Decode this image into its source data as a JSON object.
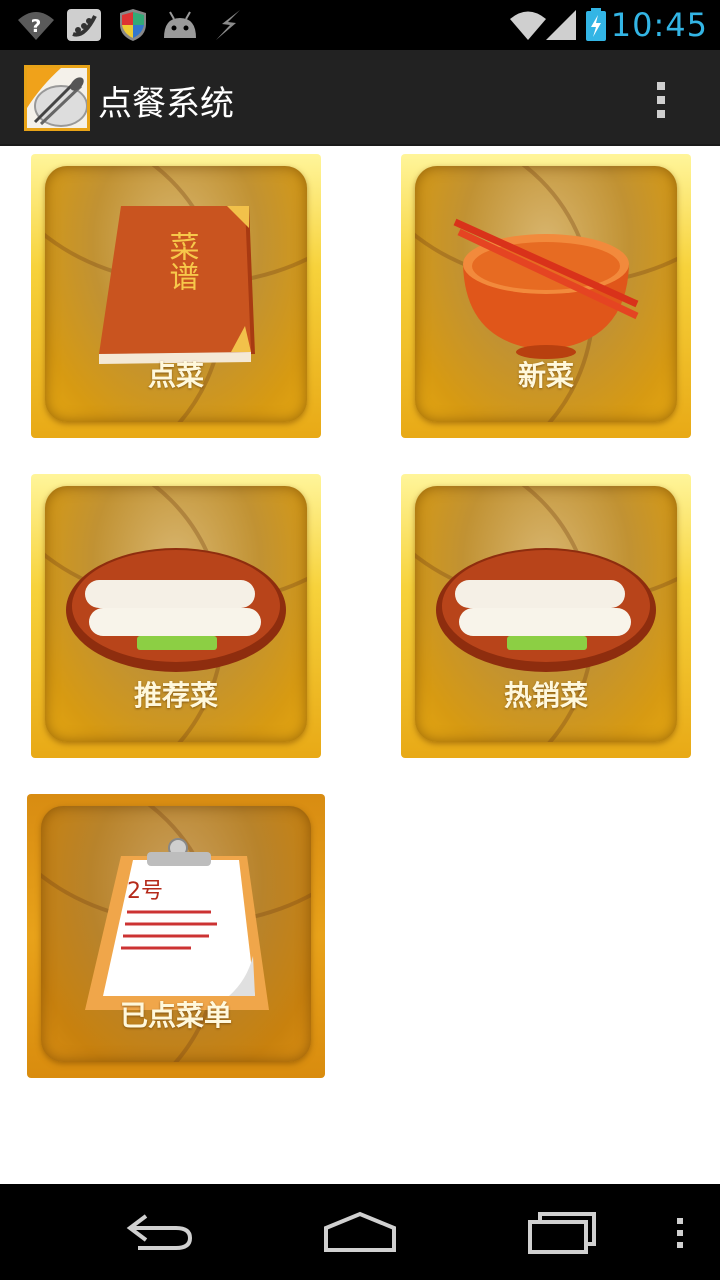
{
  "status_bar": {
    "time": "10:45",
    "icons": [
      "wifi-unknown-icon",
      "peas-notification-icon",
      "shield-icon",
      "android-icon",
      "flash-icon",
      "wifi-icon",
      "signal-icon",
      "battery-charging-icon"
    ]
  },
  "action_bar": {
    "title": "点餐系统",
    "app_icon": "plate-utensils-icon",
    "menu_icon": "overflow-menu-icon"
  },
  "tiles": [
    {
      "label": "点菜",
      "icon": "menu-book-icon",
      "book_text": "菜谱"
    },
    {
      "label": "新菜",
      "icon": "bowl-chopsticks-icon"
    },
    {
      "label": "推荐菜",
      "icon": "dumpling-plate-icon"
    },
    {
      "label": "热销菜",
      "icon": "dumpling-plate-icon"
    },
    {
      "label": "已点菜单",
      "icon": "order-clipboard-icon",
      "clipboard_number": "2号"
    }
  ],
  "nav_bar": {
    "buttons": [
      "back-icon",
      "home-icon",
      "recent-apps-icon",
      "menu-icon"
    ]
  },
  "colors": {
    "accent": "#33b5e5",
    "action_bar": "#222222",
    "tile_gold": "#f7d23b",
    "tile_orange": "#e8a916"
  }
}
